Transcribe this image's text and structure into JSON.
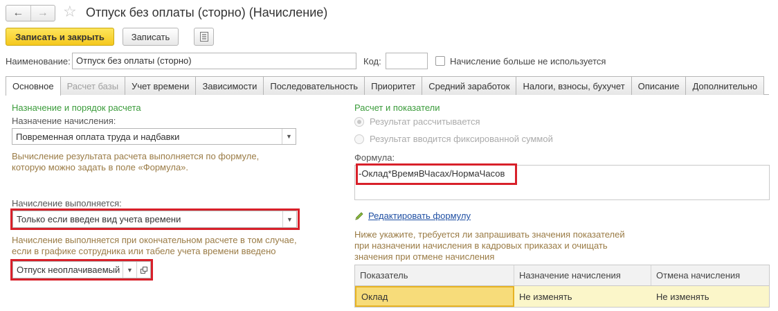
{
  "window": {
    "title": "Отпуск без оплаты (сторно) (Начисление)"
  },
  "toolbar": {
    "save_close_label": "Записать и закрыть",
    "save_label": "Записать"
  },
  "header": {
    "name_label": "Наименование:",
    "name_value": "Отпуск без оплаты (сторно)",
    "code_label": "Код:",
    "code_value": "",
    "not_used_label": "Начисление больше не используется"
  },
  "tabs": [
    {
      "label": "Основное",
      "active": true
    },
    {
      "label": "Расчет базы",
      "disabled": true
    },
    {
      "label": "Учет времени"
    },
    {
      "label": "Зависимости"
    },
    {
      "label": "Последовательность"
    },
    {
      "label": "Приоритет"
    },
    {
      "label": "Средний заработок"
    },
    {
      "label": "Налоги, взносы, бухучет"
    },
    {
      "label": "Описание"
    },
    {
      "label": "Дополнительно"
    }
  ],
  "left": {
    "section_title": "Назначение и порядок расчета",
    "purpose_label": "Назначение начисления:",
    "purpose_value": "Повременная оплата труда и надбавки",
    "formula_hint_1": "Вычисление результата расчета выполняется по формуле,",
    "formula_hint_2": "которую можно задать в поле «Формула».",
    "performed_label": "Начисление выполняется:",
    "performed_value": "Только если введен вид учета времени",
    "performed_hint_1": "Начисление выполняется при окончательном расчете в том случае,",
    "performed_hint_2": "если в графике сотрудника или табеле учета времени введено",
    "time_type_value": "Отпуск неоплачиваемый"
  },
  "right": {
    "section_title": "Расчет и показатели",
    "radio_calculated": "Результат рассчитывается",
    "radio_fixed": "Результат вводится фиксированной суммой",
    "formula_label": "Формула:",
    "formula_value": "-Оклад*ВремяВЧасах/НормаЧасов",
    "edit_formula_link": "Редактировать формулу",
    "indicators_hint_1": "Ниже укажите, требуется ли запрашивать значения показателей",
    "indicators_hint_2": "при назначении начисления в кадровых приказах и очищать",
    "indicators_hint_3": "значения при отмене начисления"
  },
  "table": {
    "columns": [
      "Показатель",
      "Назначение начисления",
      "Отмена начисления"
    ],
    "rows": [
      {
        "indicator": "Оклад",
        "assign": "Не изменять",
        "cancel": "Не изменять"
      }
    ]
  },
  "colors": {
    "primary_button": "#f5c81d",
    "section_title": "#3a9b3a",
    "hint_text": "#9a7b45",
    "highlight_border": "#d8202a",
    "link": "#1f4fa3"
  },
  "icons": {
    "back": "arrow-left-icon",
    "forward": "arrow-right-icon",
    "favorite": "star-icon",
    "list": "list-icon",
    "open": "open-icon",
    "edit": "pencil-icon"
  }
}
